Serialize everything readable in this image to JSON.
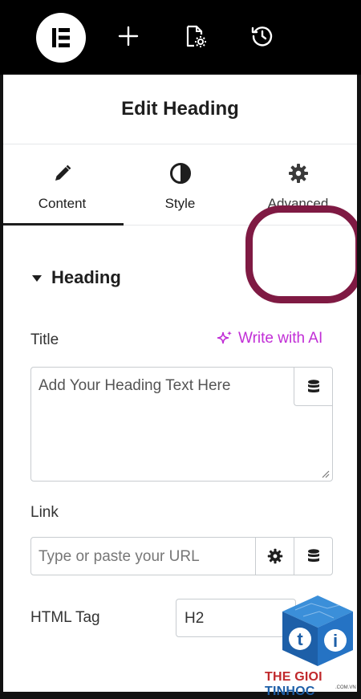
{
  "toolbar": {
    "logo": "elementor-logo-icon",
    "icons": [
      "plus-icon",
      "page-settings-icon",
      "history-icon"
    ]
  },
  "panel": {
    "title": "Edit Heading"
  },
  "tabs": [
    {
      "label": "Content",
      "icon": "pencil-icon",
      "active": true
    },
    {
      "label": "Style",
      "icon": "half-circle-icon",
      "active": false
    },
    {
      "label": "Advanced",
      "icon": "gear-icon",
      "active": false
    }
  ],
  "section": {
    "title": "Heading"
  },
  "title_field": {
    "label": "Title",
    "ai_link": "Write with AI",
    "placeholder": "Add Your Heading Text Here"
  },
  "link_field": {
    "label": "Link",
    "placeholder": "Type or paste your URL"
  },
  "html_tag": {
    "label": "HTML Tag",
    "value": "H2"
  },
  "watermark": {
    "brand_part1": "THE GIOI ",
    "brand_part2": "TINHOC",
    "domain": ".COM.VN"
  },
  "colors": {
    "accent_ai": "#c12ed6",
    "annotation": "#7f1a43",
    "topbar": "#000000"
  }
}
